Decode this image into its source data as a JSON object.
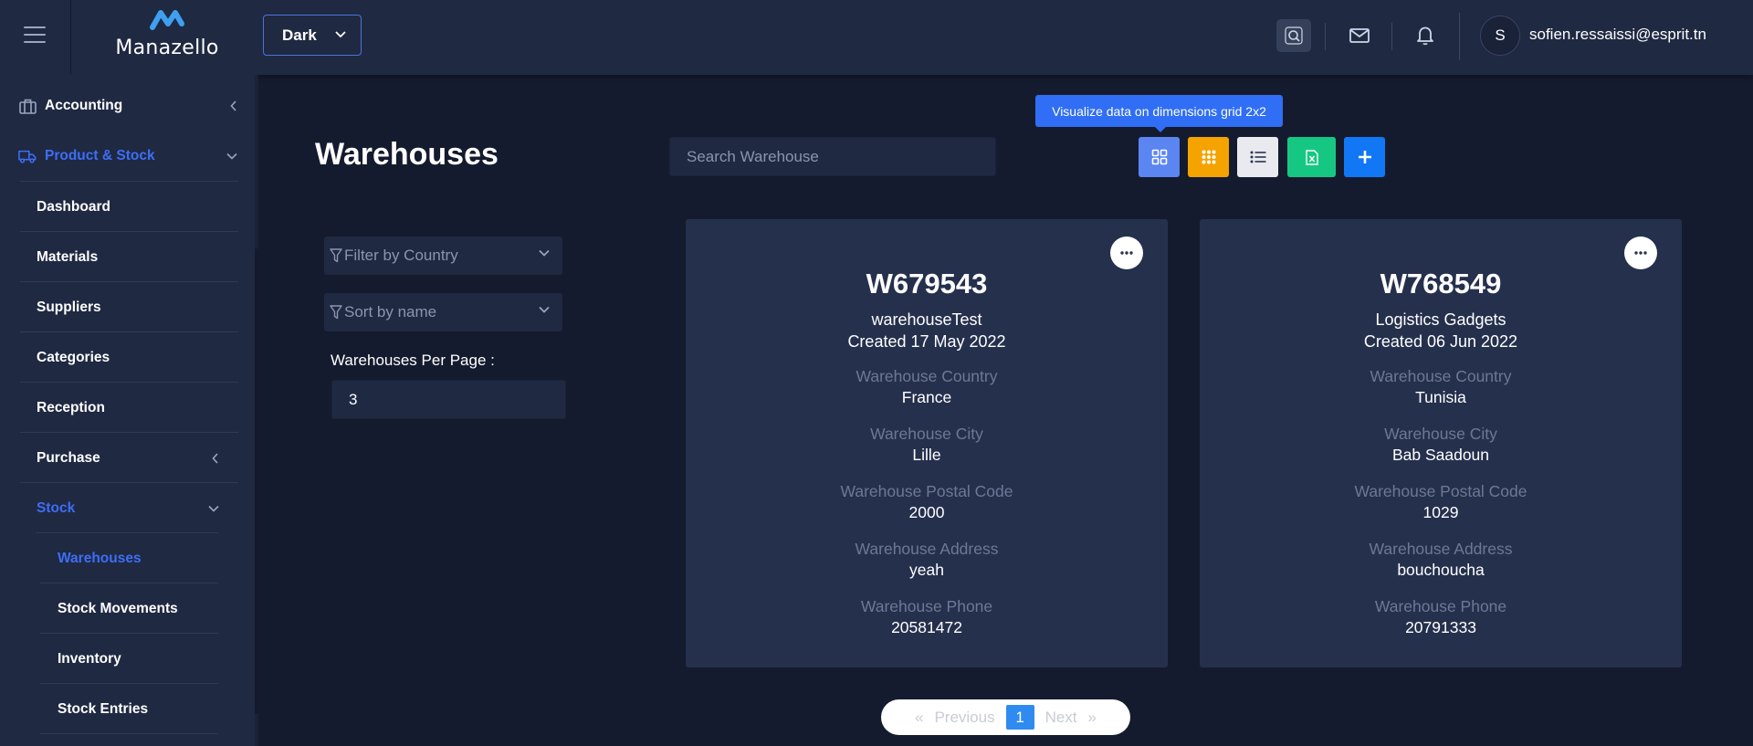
{
  "header": {
    "logo_text": "Manazello",
    "theme": "Dark",
    "user_initial": "S",
    "user_email": "sofien.ressaissi@esprit.tn"
  },
  "sidebar": {
    "accounting": "Accounting",
    "product_stock": "Product & Stock",
    "sub_items": [
      "Dashboard",
      "Materials",
      "Suppliers",
      "Categories",
      "Reception",
      "Purchase",
      "Stock"
    ],
    "stock_items": [
      "Warehouses",
      "Stock Movements",
      "Inventory",
      "Stock Entries"
    ]
  },
  "main": {
    "title": "Warehouses",
    "search_placeholder": "Search Warehouse",
    "tooltip": "Visualize data on dimensions grid 2x2",
    "filter_country": "Filter by Country",
    "sort_name": "Sort by name",
    "per_page_label": "Warehouses Per Page :",
    "per_page_value": "3"
  },
  "labels": {
    "country": "Warehouse Country",
    "city": "Warehouse City",
    "postal": "Warehouse Postal Code",
    "address": "Warehouse Address",
    "phone": "Warehouse Phone"
  },
  "cards": [
    {
      "code": "W679543",
      "name": "warehouseTest",
      "created": "Created 17 May 2022",
      "country": "France",
      "city": "Lille",
      "postal": "2000",
      "address": "yeah",
      "phone": "20581472"
    },
    {
      "code": "W768549",
      "name": "Logistics Gadgets",
      "created": "Created 06 Jun 2022",
      "country": "Tunisia",
      "city": "Bab Saadoun",
      "postal": "1029",
      "address": "bouchoucha",
      "phone": "20791333"
    }
  ],
  "pagination": {
    "first": "«",
    "previous": "Previous",
    "current": "1",
    "next": "Next",
    "last": "»"
  },
  "colors": {
    "accent": "#3d6ef5",
    "grid_2x2": "#5b85f0",
    "grid_3x3": "#f5a300",
    "list": "#e8eaef",
    "excel": "#16c784",
    "add": "#1177f5"
  },
  "icons": [
    "menu-icon",
    "search-icon",
    "mail-icon",
    "bell-icon",
    "briefcase-icon",
    "truck-icon",
    "filter-icon",
    "more-icon"
  ]
}
